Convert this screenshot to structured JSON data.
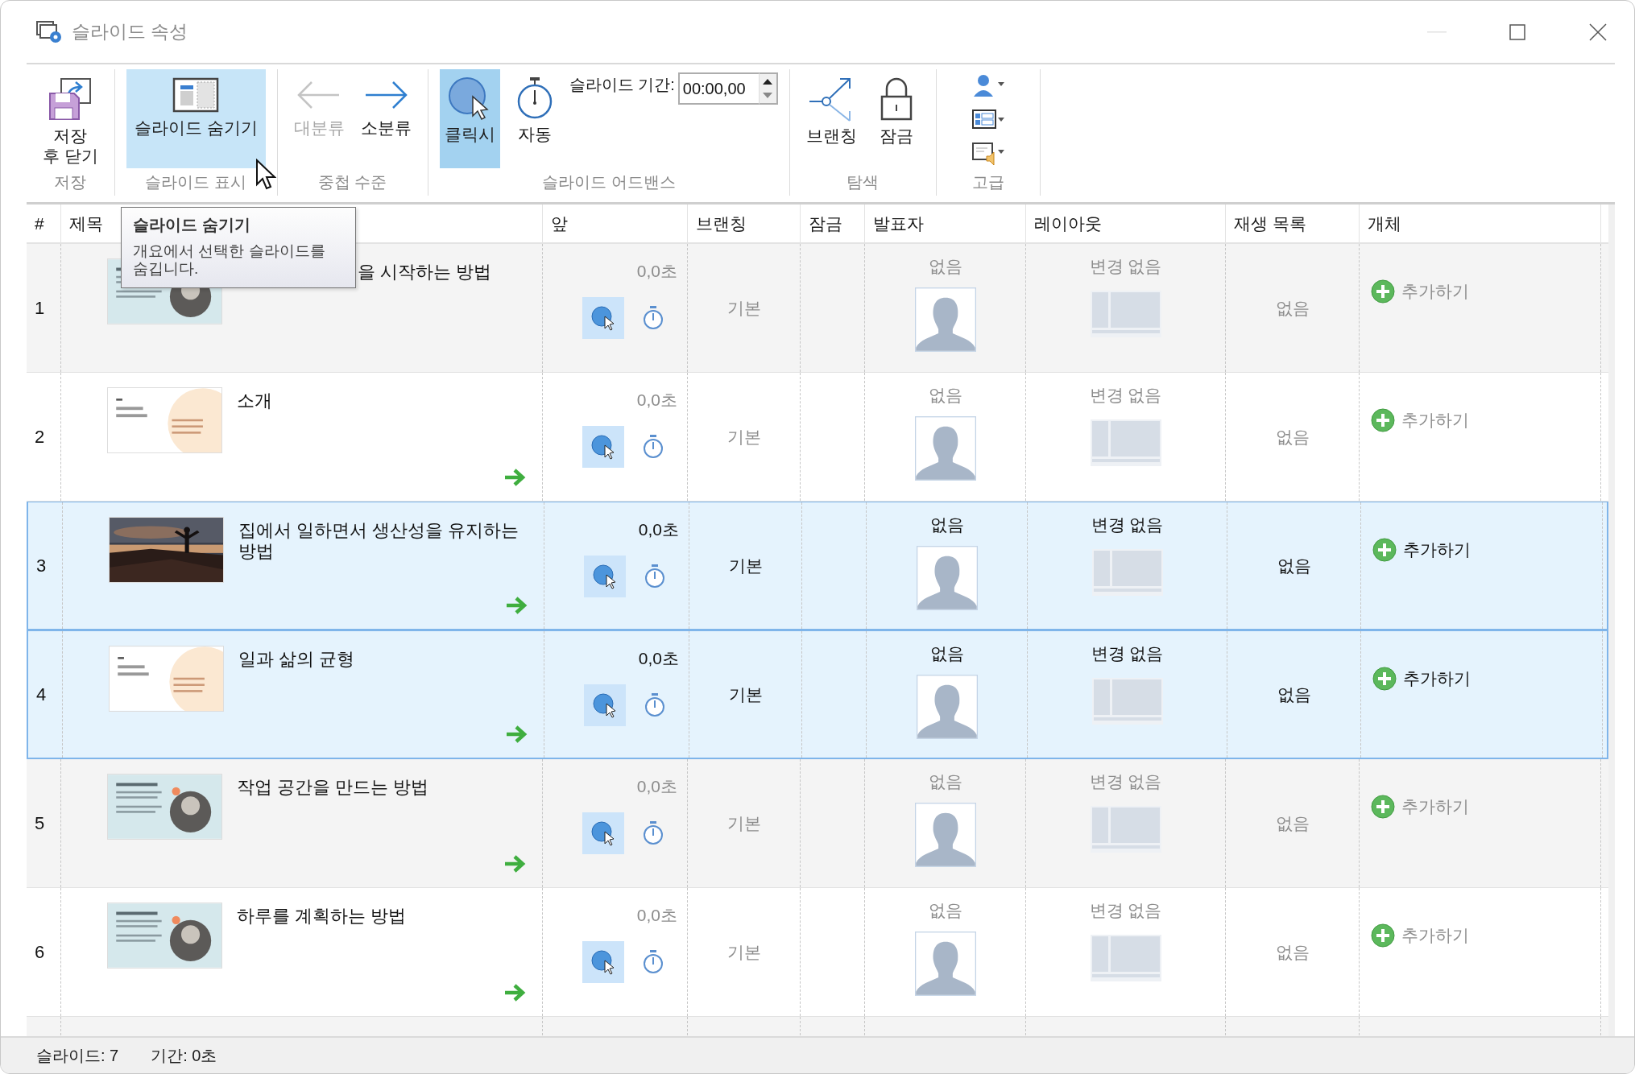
{
  "window": {
    "title": "슬라이드 속성"
  },
  "toolbar": {
    "groups": [
      {
        "label": "저장",
        "items": [
          {
            "kind": "save",
            "label": "저장\n후 닫기"
          }
        ]
      },
      {
        "label": "슬라이드 표시",
        "items": [
          {
            "kind": "hide",
            "label": "슬라이드 숨기기",
            "highlighted": true
          }
        ]
      },
      {
        "label": "중첩 수준",
        "items": [
          {
            "kind": "prev",
            "label": "대분류",
            "disabled": true
          },
          {
            "kind": "next",
            "label": "소분류",
            "disabled": false
          }
        ]
      },
      {
        "label": "슬라이드 어드밴스",
        "items": [
          {
            "kind": "click",
            "label": "클릭시",
            "selected": true
          },
          {
            "kind": "auto",
            "label": "자동",
            "selected": false
          },
          {
            "kind": "duration",
            "label": "슬라이드 기간:",
            "value": "00:00,00"
          }
        ]
      },
      {
        "label": "탐색",
        "items": [
          {
            "kind": "branch",
            "label": "브랜칭"
          },
          {
            "kind": "lock",
            "label": "잠금"
          }
        ]
      },
      {
        "label": "고급",
        "items": [
          {
            "kind": "menus"
          }
        ]
      }
    ]
  },
  "tooltip": {
    "title": "슬라이드 숨기기",
    "text": "개요에서 선택한 슬라이드를 숨깁니다."
  },
  "table": {
    "columns": [
      "#",
      "제목",
      "앞",
      "브랜칭",
      "잠금",
      "발표자",
      "레이아웃",
      "재생 목록",
      "개체"
    ],
    "rows": [
      {
        "number": "1",
        "title": "을 시작하는 방법",
        "covered": true,
        "thumbnail": {
          "kind": "teal"
        },
        "arrow": false,
        "advance": "0,0초",
        "on_click": true,
        "automatic": false,
        "branching": "기본",
        "presenter": "없음",
        "layout": "변경 없음",
        "playlist": "없음",
        "objects": "추가하기",
        "selected": false
      },
      {
        "number": "2",
        "title": "소개",
        "covered": false,
        "thumbnail": {
          "kind": "cream"
        },
        "arrow": true,
        "advance": "0,0초",
        "on_click": true,
        "automatic": false,
        "branching": "기본",
        "presenter": "없음",
        "layout": "변경 없음",
        "playlist": "없음",
        "objects": "추가하기",
        "selected": false
      },
      {
        "number": "3",
        "title": "집에서 일하면서 생산성을 유지하는 방법",
        "covered": false,
        "arrow": true,
        "advance": "0,0초",
        "on_click": true,
        "automatic": false,
        "branching": "기본",
        "presenter": "없음",
        "layout": "변경 없음",
        "playlist": "없음",
        "objects": "추가하기",
        "selected": true
      },
      {
        "number": "4",
        "title": "일과 삶의 균형",
        "covered": false,
        "thumbnail": {
          "kind": "cream"
        },
        "arrow": true,
        "advance": "0,0초",
        "on_click": true,
        "automatic": false,
        "branching": "기본",
        "presenter": "없음",
        "layout": "변경 없음",
        "playlist": "없음",
        "objects": "추가하기",
        "selected": true
      },
      {
        "number": "5",
        "title": "작업 공간을 만드는 방법",
        "covered": false,
        "thumbnail": {
          "kind": "teal"
        },
        "arrow": true,
        "advance": "0,0초",
        "on_click": true,
        "automatic": false,
        "branching": "기본",
        "presenter": "없음",
        "layout": "변경 없음",
        "playlist": "없음",
        "objects": "추가하기",
        "selected": false
      },
      {
        "number": "6",
        "title": "하루를 계획하는 방법",
        "covered": false,
        "thumbnail": {
          "kind": "teal"
        },
        "arrow": true,
        "advance": "0,0초",
        "on_click": true,
        "automatic": false,
        "branching": "기본",
        "presenter": "없음",
        "layout": "변경 없음",
        "playlist": "없음",
        "objects": "추가하기",
        "selected": false
      }
    ]
  },
  "status_bar": [
    "슬라이드: 7",
    "기간:  0초"
  ]
}
